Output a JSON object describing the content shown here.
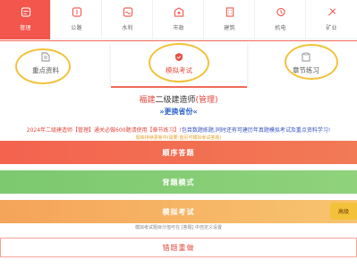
{
  "nav": {
    "items": [
      {
        "label": "管理",
        "icon": "management-icon",
        "active": true
      },
      {
        "label": "公路",
        "icon": "road-icon",
        "active": false
      },
      {
        "label": "水利",
        "icon": "water-icon",
        "active": false
      },
      {
        "label": "市政",
        "icon": "municipal-icon",
        "active": false
      },
      {
        "label": "建筑",
        "icon": "building-icon",
        "active": false
      },
      {
        "label": "机电",
        "icon": "electromechanical-icon",
        "active": false
      },
      {
        "label": "矿业",
        "icon": "mining-icon",
        "active": false
      }
    ]
  },
  "modes": {
    "key_material": "重点资料",
    "mock_exam": "模拟考试",
    "chapter_practice": "章节练习"
  },
  "header": {
    "title_prefix": "福建",
    "title_mid": "二级建造师",
    "title_suffix": "(管理)",
    "switch_subject": "»更换省份«"
  },
  "notice": {
    "line1_red": "2024年二级建造师【管理】通关必做600题请使用【章节练习】!",
    "line1_blue": "包目数题练题,同时还有可建历年真题模拟考试及重点资料学习!",
    "line2": "题库持续更新中(需要:首页可模拟考试答题)"
  },
  "buttons": {
    "order": "顺序答题",
    "recite": "背题模式",
    "exam": "模拟考试",
    "exam_tag": "高级",
    "exam_note": "模拟考试题目分值可在 [答题] 中自定义设置",
    "wrong": "错题重做"
  },
  "colors": {
    "accent": "#f2564c",
    "highlight": "#f3c23a",
    "green": "#7cc96f",
    "orange": "#f5a45a"
  }
}
